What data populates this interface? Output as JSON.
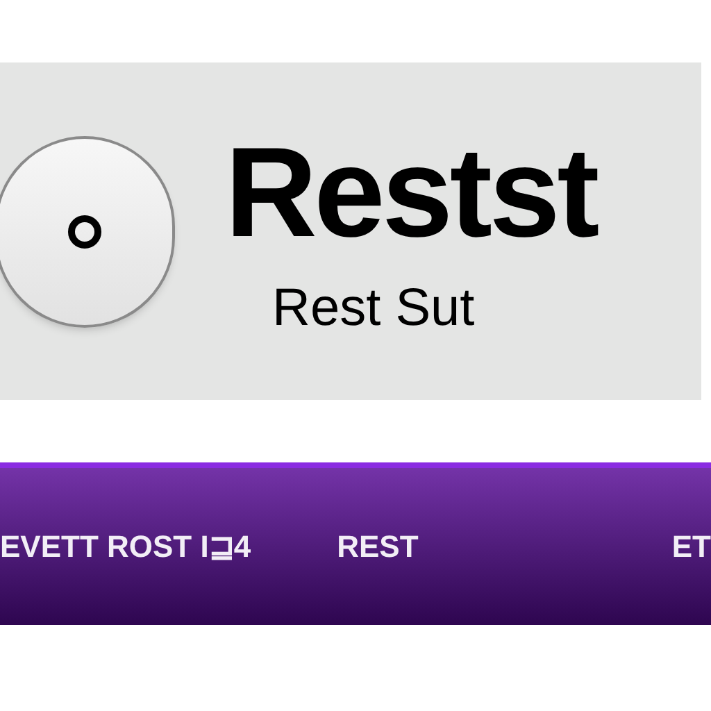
{
  "panel": {
    "title": "Restst",
    "subtitle": "Rest Sut",
    "button": {
      "selected": true
    }
  },
  "bar": {
    "items": [
      {
        "label": "EVETT ROST I⊒4"
      },
      {
        "label": "REST"
      },
      {
        "label": "ET"
      }
    ]
  }
}
